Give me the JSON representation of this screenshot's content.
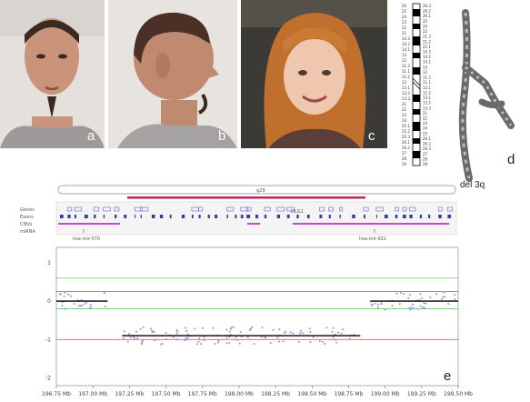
{
  "panels": {
    "a": {
      "letter": "a"
    },
    "b": {
      "letter": "b"
    },
    "c": {
      "letter": "c"
    },
    "d": {
      "letter": "d",
      "caption": "del 3q"
    },
    "e": {
      "letter": "e"
    }
  },
  "ideogram": {
    "left_labels": [
      "26",
      "25",
      "24",
      "23",
      "22",
      "21",
      "14.3",
      "14.2",
      "14.1",
      "13",
      "12",
      "11.2",
      "11.1",
      "11.2",
      "12",
      "13.1",
      "13.2",
      "13.3",
      "21",
      "22",
      "23",
      "24",
      "25.1",
      "25.2",
      "25.3",
      "26.1",
      "26.2",
      "27",
      "28",
      "29"
    ],
    "right_labels": [
      "26.3",
      "26.2",
      "26.1",
      "25",
      "24",
      "22",
      "21.3",
      "21.2",
      "21.1",
      "14.3",
      "14.2",
      "14.1",
      "13",
      "12",
      "11.2",
      "11.1",
      "12.1",
      "12.2",
      "13.1",
      "13.2",
      "13.3",
      "21",
      "22",
      "23",
      "24",
      "25",
      "26.1",
      "26.2",
      "26.3",
      "27",
      "28",
      "29"
    ]
  },
  "genome_browser": {
    "band_label": "q29",
    "track_labels": [
      "Genes",
      "Exons",
      "CNVs",
      "miRNA"
    ],
    "mirna_labels": [
      "hsa-mir-570",
      "hsa-mir-922"
    ],
    "gene_label": "DLG1"
  },
  "chart_data": {
    "type": "scatter",
    "x_unit": "Mb",
    "xlim": [
      196.75,
      199.5
    ],
    "ylim": [
      -2.2,
      1.4
    ],
    "x_ticks": [
      "196.75 Mb",
      "197.00 Mb",
      "197.25 Mb",
      "197.50 Mb",
      "197.75 Mb",
      "198.00 Mb",
      "198.25 Mb",
      "198.50 Mb",
      "198.75 Mb",
      "199.00 Mb",
      "199.25 Mb",
      "199.50 Mb"
    ],
    "y_ticks": [
      "1",
      "0",
      "-1",
      "-2"
    ],
    "y_tick_values": [
      1,
      0,
      -1,
      -2
    ],
    "reference_lines": [
      {
        "value": 0.6,
        "color": "#66cc66"
      },
      {
        "value": 0.25,
        "color": "#e06060"
      },
      {
        "value": -0.2,
        "color": "#66cc66"
      },
      {
        "value": -1.0,
        "color": "#e06060"
      }
    ],
    "segments": [
      {
        "x0": 196.75,
        "x1": 197.1,
        "value": 0.0
      },
      {
        "x0": 197.2,
        "x1": 198.83,
        "value": -0.9
      },
      {
        "x0": 198.9,
        "x1": 199.5,
        "value": 0.0
      }
    ],
    "points_color": "#9a8ee0"
  }
}
